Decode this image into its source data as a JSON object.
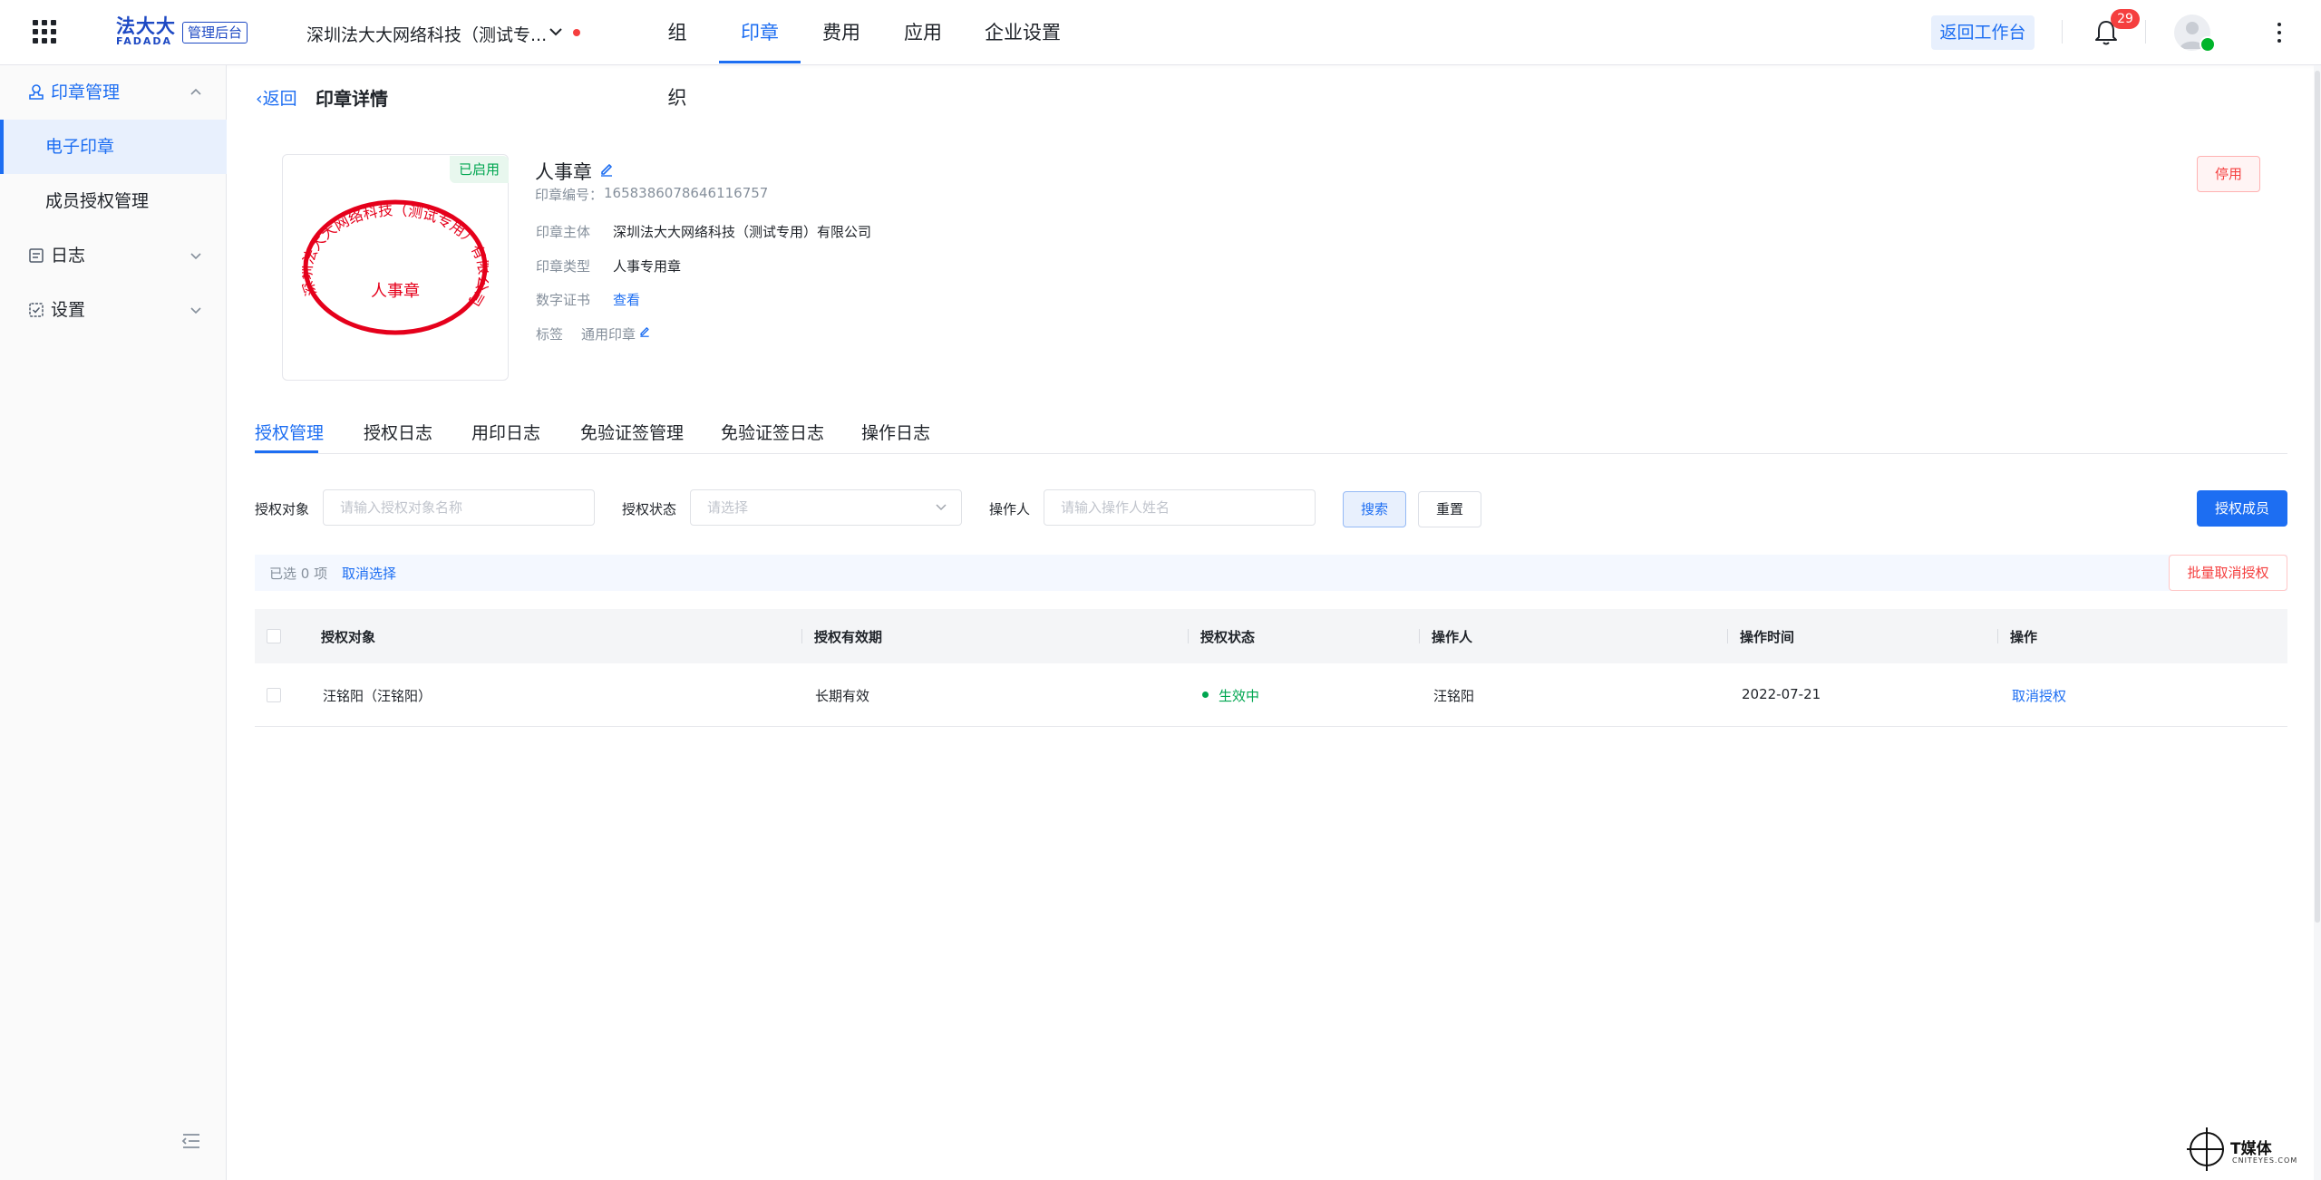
{
  "topbar": {
    "logo_cn": "法大大",
    "logo_en": "FADADA",
    "admin_badge": "管理后台",
    "company": "深圳法大大网络科技（测试专...",
    "nav": [
      {
        "label": "组织"
      },
      {
        "label": "印章"
      },
      {
        "label": "费用"
      },
      {
        "label": "应用"
      },
      {
        "label": "企业设置"
      }
    ],
    "active_nav": "印章",
    "return_label": "返回工作台",
    "notification_count": "29",
    "accent_color": "#1d6ef2"
  },
  "sidebar": {
    "seal_group": "印章管理",
    "items": [
      {
        "label": "电子印章",
        "active": true
      },
      {
        "label": "成员授权管理",
        "active": false
      }
    ],
    "log_group": "日志",
    "settings_group": "设置"
  },
  "page": {
    "back_label": "返回",
    "title": "印章详情"
  },
  "seal": {
    "status_badge": "已启用",
    "name": "人事章",
    "number_label": "印章编号：",
    "number": "1658386078646116757",
    "image_ring_text": "深圳法大大网络科技（测试专用）有限公司",
    "image_center_text": "人事章",
    "seal_color": "#e5001b",
    "fields": {
      "owner_label": "印章主体",
      "owner_value": "深圳法大大网络科技（测试专用）有限公司",
      "type_label": "印章类型",
      "type_value": "人事专用章",
      "cert_label": "数字证书",
      "cert_value": "查看",
      "tag_label": "标签",
      "tag_value": "通用印章"
    },
    "disable_label": "停用"
  },
  "tabs": [
    {
      "label": "授权管理",
      "active": true
    },
    {
      "label": "授权日志",
      "active": false
    },
    {
      "label": "用印日志",
      "active": false
    },
    {
      "label": "免验证签管理",
      "active": false
    },
    {
      "label": "免验证签日志",
      "active": false
    },
    {
      "label": "操作日志",
      "active": false
    }
  ],
  "filters": {
    "target_label": "授权对象",
    "target_placeholder": "请输入授权对象名称",
    "status_label": "授权状态",
    "status_placeholder": "请选择",
    "operator_label": "操作人",
    "operator_placeholder": "请输入操作人姓名",
    "search_label": "搜索",
    "reset_label": "重置",
    "grant_label": "授权成员"
  },
  "selection": {
    "count_text": "已选 0 项",
    "cancel_label": "取消选择",
    "batch_label": "批量取消授权"
  },
  "table": {
    "columns": [
      "授权对象",
      "授权有效期",
      "授权状态",
      "操作人",
      "操作时间",
      "操作"
    ],
    "rows": [
      {
        "target": "汪铭阳（汪铭阳）",
        "validity": "长期有效",
        "status": "生效中",
        "operator": "汪铭阳",
        "time": "2022-07-21",
        "action": "取消授权"
      }
    ]
  },
  "watermark": {
    "text": "T媒体",
    "sub": "CNITEYES.COM"
  }
}
